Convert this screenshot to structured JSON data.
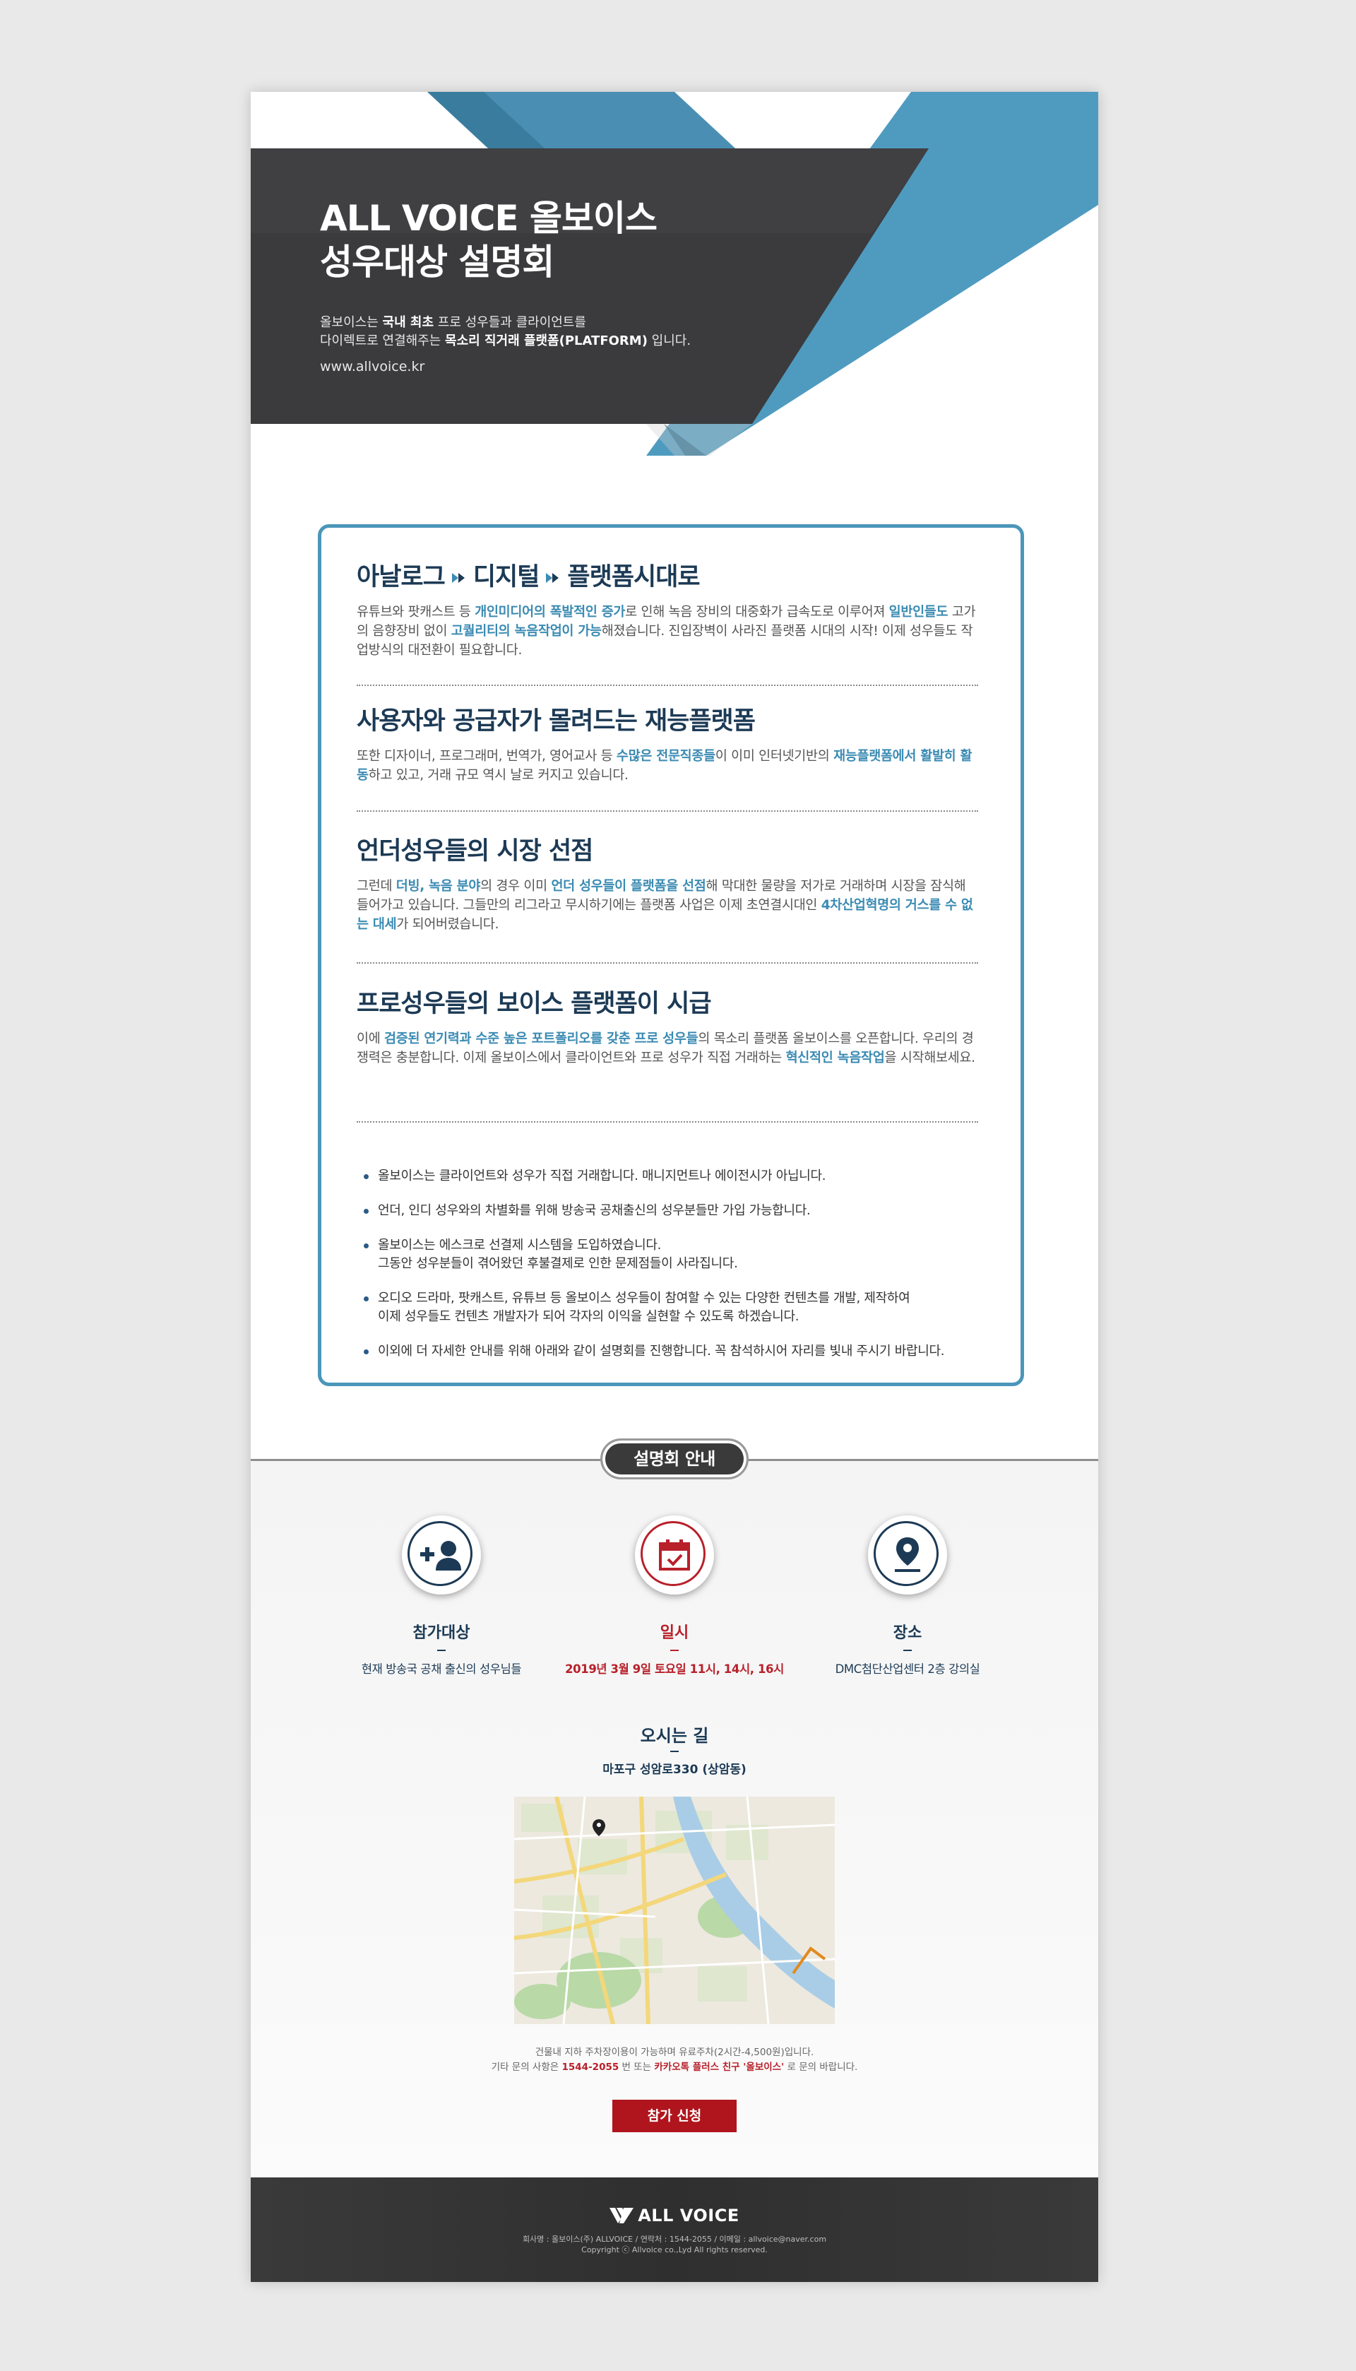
{
  "colors": {
    "accent_blue": "#4b96b9",
    "navy": "#1c3a55",
    "red": "#b8202a",
    "dark": "#333333"
  },
  "hero": {
    "title_line1": "ALL VOICE 올보이스",
    "title_line2": "성우대상 설명회",
    "desc_pre": "올보이스는 ",
    "desc_b1": "국내 최초",
    "desc_mid": " 프로 성우들과 클라이언트를",
    "desc2_pre": "다이렉트로 연결해주는 ",
    "desc_b2": "목소리 직거래 플랫폼(PLATFORM)",
    "desc2_post": " 입니다.",
    "url": "www.allvoice.kr"
  },
  "sections": [
    {
      "title_a": "아날로그",
      "title_b": "디지털",
      "title_c": "플랫폼시대로",
      "p": [
        "유튜브와 팟캐스트 등 ",
        "개인미디어의 폭발적인 증가",
        "로 인해 녹음 장비의 대중화가 급속도로 이루어져 ",
        "일반인들도",
        " 고가의 음향장비 없이 ",
        "고퀄리티의 녹음작업이 가능",
        "해졌습니다. 진입장벽이 사라진 플랫폼 시대의 시작! 이제 성우들도 작업방식의 대전환이 필요합니다."
      ]
    },
    {
      "title": "사용자와 공급자가 몰려드는 재능플랫폼",
      "p": [
        "또한 디자이너, 프로그래머, 번역가, 영어교사 등 ",
        "수많은 전문직종들",
        "이 이미 인터넷기반의 ",
        "재능플랫폼에서 활발히 활동",
        "하고 있고, 거래 규모 역시 날로 커지고 있습니다."
      ]
    },
    {
      "title": "언더성우들의 시장 선점",
      "p": [
        "그런데 ",
        "더빙, 녹음 분야",
        "의 경우 이미 ",
        "언더 성우들이 플랫폼을 선점",
        "해 막대한 물량을 저가로 거래하며 시장을 잠식해 들어가고 있습니다. 그들만의 리그라고 무시하기에는 플랫폼 사업은 이제 초연결시대인 ",
        "4차산업혁명의 거스를 수 없는 대세",
        "가 되어버렸습니다."
      ]
    },
    {
      "title": "프로성우들의 보이스 플랫폼이 시급",
      "p": [
        "이에 ",
        "검증된 연기력과 수준 높은 포트폴리오를 갖춘 프로 성우들",
        "의 목소리 플랫폼 올보이스를 오픈합니다. 우리의 경쟁력은 충분합니다. 이제 올보이스에서 클라이언트와 프로 성우가 직접 거래하는 ",
        "혁신적인 녹음작업",
        "을 시작해보세요."
      ]
    }
  ],
  "bullets": [
    {
      "l1": "올보이스는 클라이언트와 성우가 직접 거래합니다. 매니지먼트나 에이전시가 아닙니다.",
      "l2": ""
    },
    {
      "l1": "언더, 인디 성우와의 차별화를 위해 방송국 공채출신의 성우분들만 가입 가능합니다.",
      "l2": ""
    },
    {
      "l1": "올보이스는 에스크로 선결제 시스템을 도입하였습니다.",
      "l2": "그동안 성우분들이 겪어왔던 후불결제로 인한 문제점들이 사라집니다."
    },
    {
      "l1": "오디오 드라마, 팟캐스트, 유튜브 등 올보이스 성우들이 참여할 수 있는 다양한 컨텐츠를 개발, 제작하여",
      "l2": "이제 성우들도 컨텐츠 개발자가 되어 각자의 이익을 실현할 수 있도록 하겠습니다."
    },
    {
      "l1": "이외에 더 자세한 안내를 위해 아래와 같이 설명회를 진행합니다. 꼭 참석하시어 자리를 빛내 주시기 바랍니다.",
      "l2": ""
    }
  ],
  "guide": {
    "pill": "설명회 안내",
    "items": [
      {
        "icon": "add-user-icon",
        "label": "참가대상",
        "text": "현재 방송국 공채 출신의 성우님들"
      },
      {
        "icon": "calendar-check-icon",
        "label": "일시",
        "text": "2019년 3월 9일 토요일  11시, 14시, 16시"
      },
      {
        "icon": "location-pin-icon",
        "label": "장소",
        "text": "DMC첨단산업센터 2층 강의실"
      }
    ],
    "route_title": "오시는 길",
    "route_addr": "마포구 성암로330 (상암동)",
    "note1": "건물내 지하 주차장이용이 가능하며 유료주차(2시간-4,500원)입니다.",
    "note2_pre": "기타 문의 사항은 ",
    "note2_phone": "1544-2055",
    "note2_mid": " 번 또는 ",
    "note2_kakao": "카카오톡 플러스 친구 '올보이스'",
    "note2_post": " 로 문의 바랍니다.",
    "apply": "참가 신청"
  },
  "footer": {
    "logo": "ALL VOICE",
    "line1": "회사명 : 올보이스(주) ALLVOICE  /  연락처 : 1544-2055  /  이메일 : allvoice@naver.com",
    "line2": "Copyright ⓒ Allvoice co.,Lyd All rights reserved."
  }
}
